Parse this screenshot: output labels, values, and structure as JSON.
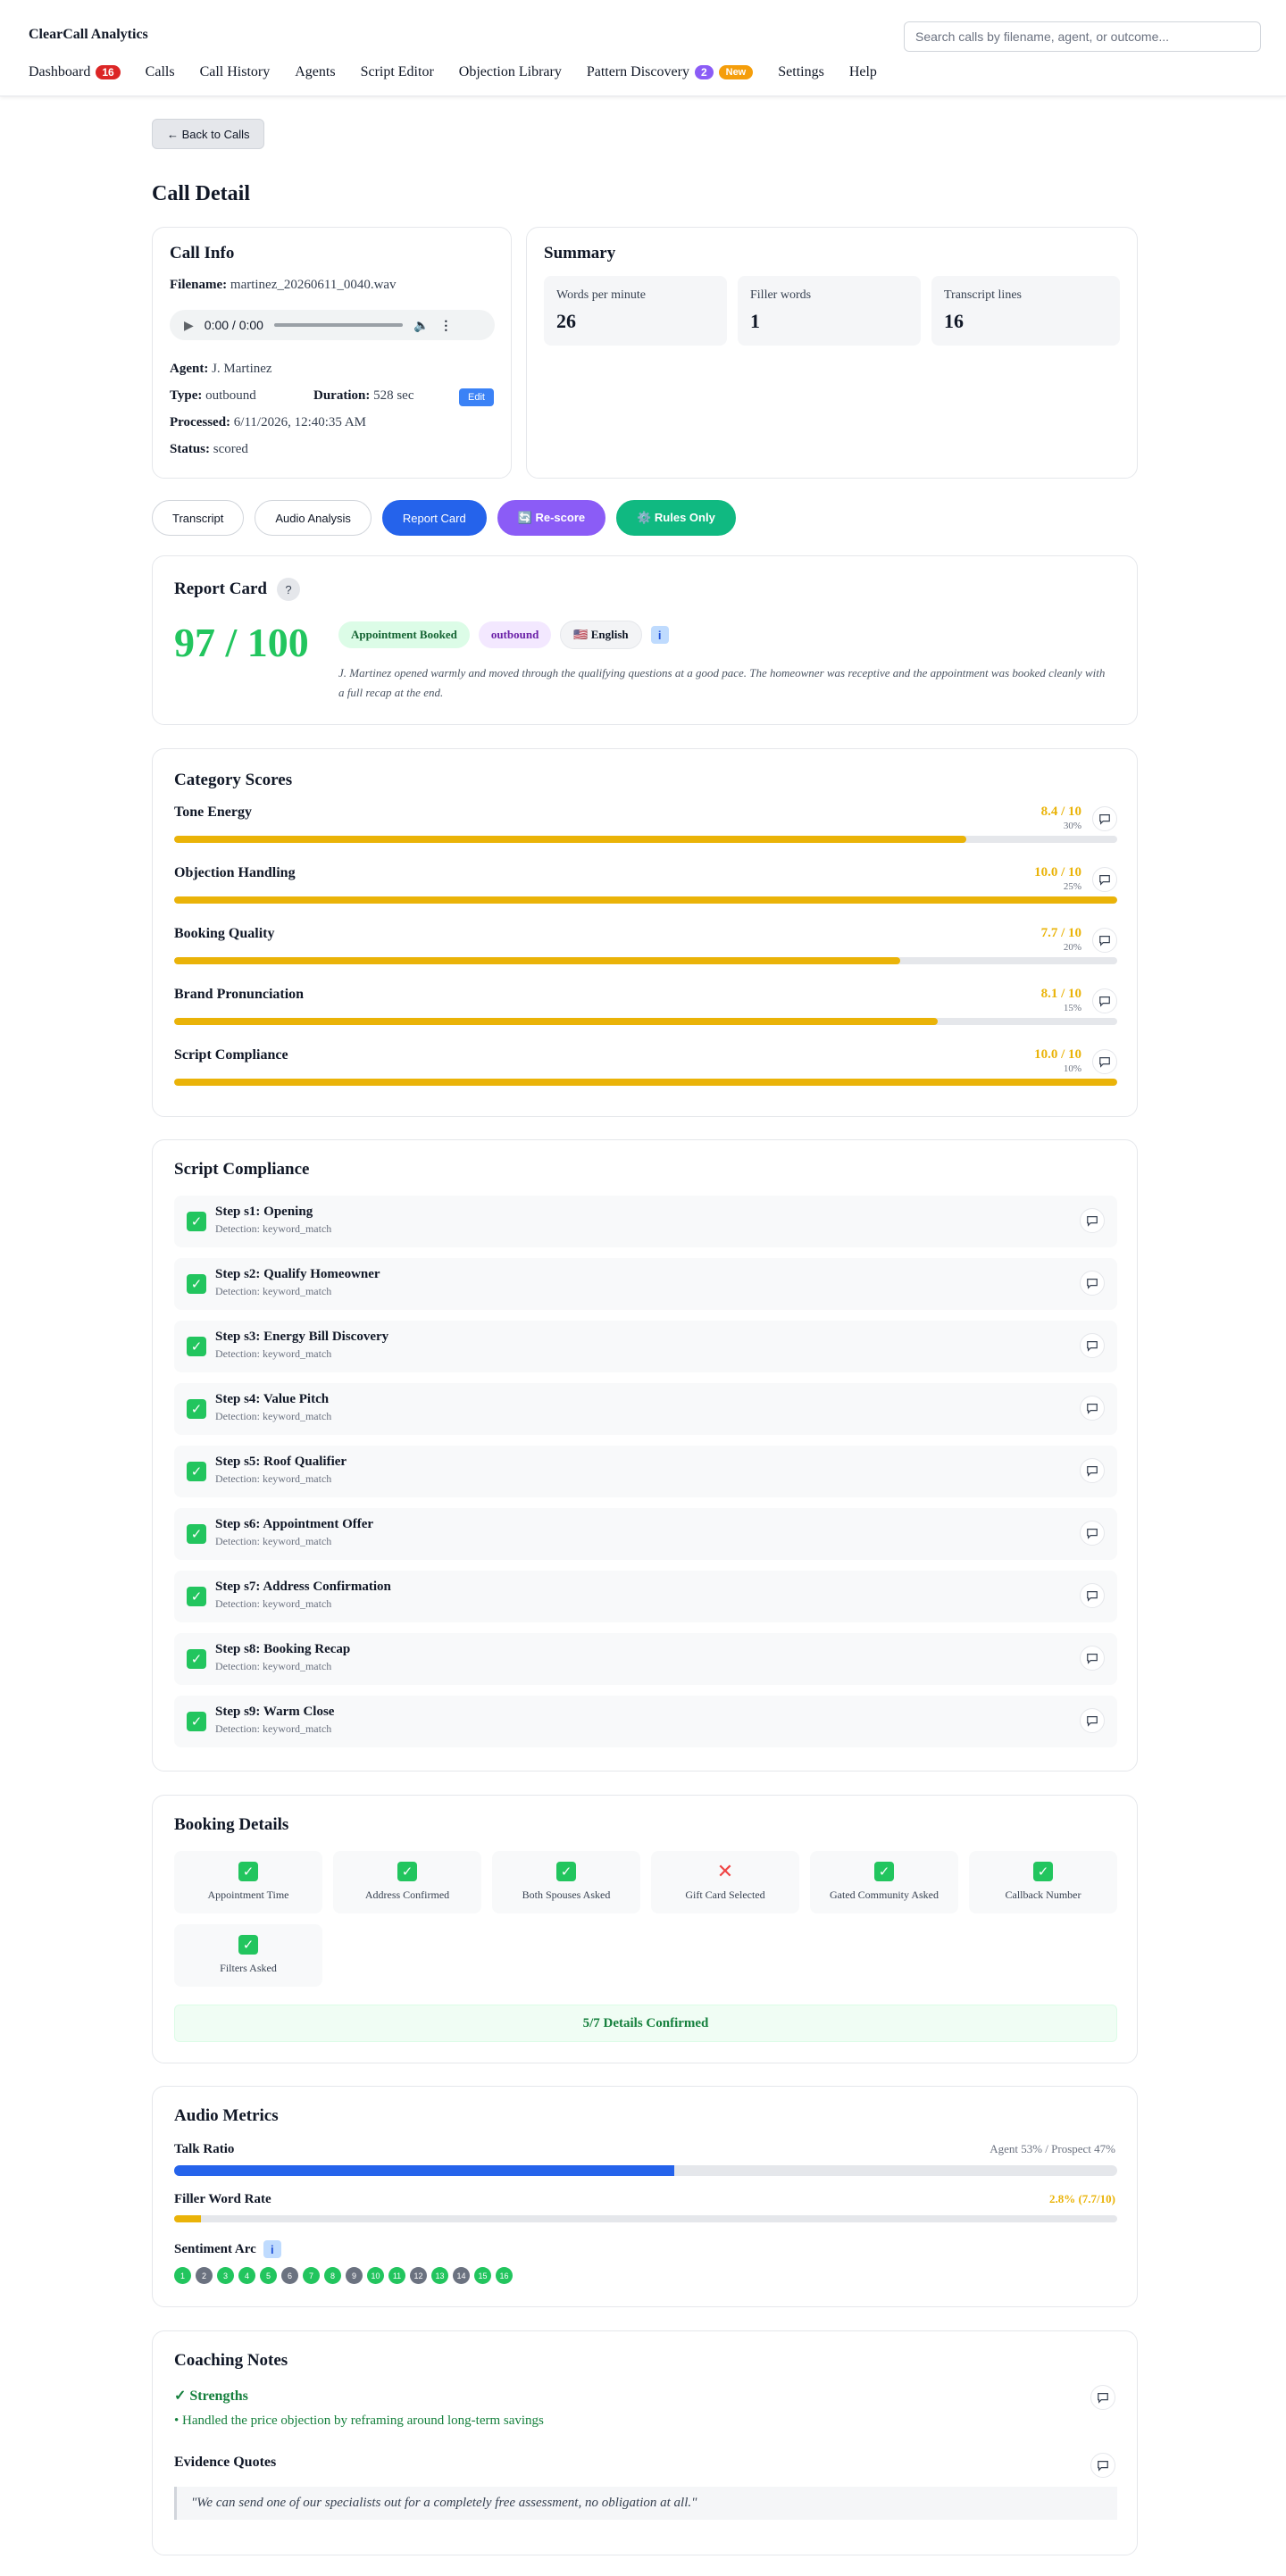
{
  "header": {
    "brand": "ClearCall Analytics",
    "search_placeholder": "Search calls by filename, agent, or outcome...",
    "nav": [
      {
        "label": "Dashboard",
        "badge": "16"
      },
      {
        "label": "Calls"
      },
      {
        "label": "Call History"
      },
      {
        "label": "Agents"
      },
      {
        "label": "Script Editor"
      },
      {
        "label": "Objection Library"
      },
      {
        "label": "Pattern Discovery",
        "badge": "2",
        "tag": "New"
      },
      {
        "label": "Settings"
      },
      {
        "label": "Help"
      }
    ]
  },
  "back_label": "← Back to Calls",
  "page_title": "Call Detail",
  "call_info": {
    "title": "Call Info",
    "filename_label": "Filename:",
    "filename": "martinez_20260611_0040.wav",
    "audio_time": "0:00 / 0:00",
    "agent_label": "Agent:",
    "agent": "J. Martinez",
    "type_label": "Type:",
    "type": "outbound",
    "duration_label": "Duration:",
    "duration": "528 sec",
    "edit_label": "Edit",
    "processed_label": "Processed:",
    "processed": "6/11/2026, 12:40:35 AM",
    "status_label": "Status:",
    "status": "scored"
  },
  "summary": {
    "title": "Summary",
    "stats": [
      {
        "label": "Words per minute",
        "value": "26"
      },
      {
        "label": "Filler words",
        "value": "1"
      },
      {
        "label": "Transcript lines",
        "value": "16"
      }
    ]
  },
  "tabs": [
    "Transcript",
    "Audio Analysis",
    "Report Card",
    "🔄 Re-score",
    "⚙️ Rules Only"
  ],
  "report_card": {
    "title": "Report Card",
    "help": "?",
    "score": "97 / 100",
    "outcome": "Appointment Booked",
    "direction": "outbound",
    "language": "🇺🇸 English",
    "summary": "J. Martinez opened warmly and moved through the qualifying questions at a good pace. The homeowner was receptive and the appointment was booked cleanly with a full recap at the end."
  },
  "category_scores": {
    "title": "Category Scores",
    "items": [
      {
        "name": "Tone Energy",
        "score": "8.4 / 10",
        "weight": "30%",
        "fraction": 0.84
      },
      {
        "name": "Objection Handling",
        "score": "10.0 / 10",
        "weight": "25%",
        "fraction": 1.0
      },
      {
        "name": "Booking Quality",
        "score": "7.7 / 10",
        "weight": "20%",
        "fraction": 0.77
      },
      {
        "name": "Brand Pronunciation",
        "score": "8.1 / 10",
        "weight": "15%",
        "fraction": 0.81
      },
      {
        "name": "Script Compliance",
        "score": "10.0 / 10",
        "weight": "10%",
        "fraction": 1.0
      }
    ],
    "score_color": "#eab308"
  },
  "script_compliance": {
    "title": "Script Compliance",
    "steps": [
      {
        "title": "Step s1: Opening",
        "detection": "Detection: keyword_match"
      },
      {
        "title": "Step s2: Qualify Homeowner",
        "detection": "Detection: keyword_match"
      },
      {
        "title": "Step s3: Energy Bill Discovery",
        "detection": "Detection: keyword_match"
      },
      {
        "title": "Step s4: Value Pitch",
        "detection": "Detection: keyword_match"
      },
      {
        "title": "Step s5: Roof Qualifier",
        "detection": "Detection: keyword_match"
      },
      {
        "title": "Step s6: Appointment Offer",
        "detection": "Detection: keyword_match"
      },
      {
        "title": "Step s7: Address Confirmation",
        "detection": "Detection: keyword_match"
      },
      {
        "title": "Step s8: Booking Recap",
        "detection": "Detection: keyword_match"
      },
      {
        "title": "Step s9: Warm Close",
        "detection": "Detection: keyword_match"
      }
    ]
  },
  "booking_details": {
    "title": "Booking Details",
    "items": [
      {
        "label": "Appointment Time",
        "ok": true
      },
      {
        "label": "Address Confirmed",
        "ok": true
      },
      {
        "label": "Both Spouses Asked",
        "ok": true
      },
      {
        "label": "Gift Card Selected",
        "ok": false
      },
      {
        "label": "Gated Community Asked",
        "ok": true
      },
      {
        "label": "Callback Number",
        "ok": true
      },
      {
        "label": "Filters Asked",
        "ok": true
      }
    ],
    "summary": "5/7 Details Confirmed"
  },
  "audio_metrics": {
    "title": "Audio Metrics",
    "talk_ratio_label": "Talk Ratio",
    "talk_ratio_value": "Agent 53% / Prospect 47%",
    "agent_share": 0.53,
    "filler_label": "Filler Word Rate",
    "filler_value": "2.8% (7.7/10)",
    "filler_fraction": 0.028,
    "sentiment_label": "Sentiment Arc",
    "sentiment": [
      {
        "n": "1",
        "tone": "positive"
      },
      {
        "n": "2",
        "tone": "neutral"
      },
      {
        "n": "3",
        "tone": "positive"
      },
      {
        "n": "4",
        "tone": "positive"
      },
      {
        "n": "5",
        "tone": "positive"
      },
      {
        "n": "6",
        "tone": "neutral"
      },
      {
        "n": "7",
        "tone": "positive"
      },
      {
        "n": "8",
        "tone": "positive"
      },
      {
        "n": "9",
        "tone": "neutral"
      },
      {
        "n": "10",
        "tone": "positive"
      },
      {
        "n": "11",
        "tone": "positive"
      },
      {
        "n": "12",
        "tone": "neutral"
      },
      {
        "n": "13",
        "tone": "positive"
      },
      {
        "n": "14",
        "tone": "neutral"
      },
      {
        "n": "15",
        "tone": "positive"
      },
      {
        "n": "16",
        "tone": "positive"
      }
    ],
    "colors": {
      "agent": "#2563eb",
      "positive": "#22c55e",
      "neutral": "#6b7280",
      "filler": "#eab308"
    }
  },
  "coaching": {
    "title": "Coaching Notes",
    "strengths_label": "✓ Strengths",
    "strengths": [
      "Handled the price objection by reframing around long-term savings"
    ],
    "evidence_label": "Evidence Quotes",
    "quote": "\"We can send one of our specialists out for a completely free assessment, no obligation at all.\""
  }
}
